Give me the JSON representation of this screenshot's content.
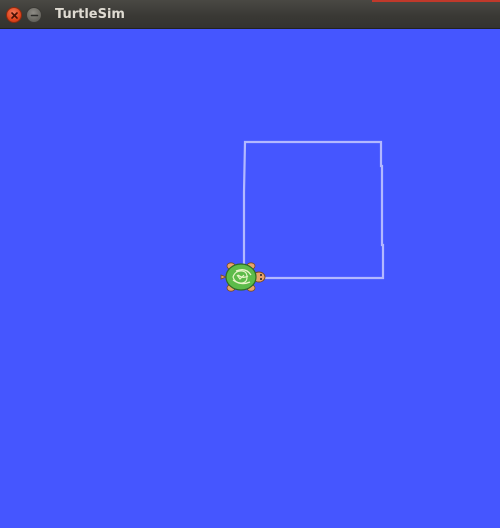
{
  "window": {
    "title": "TurtleSim"
  },
  "colors": {
    "background": "#4556FF",
    "pen": "#B3B8FF",
    "turtle_shell": "#5DBB4A",
    "turtle_skin": "#E9A36A"
  },
  "icons": {
    "close": "close-icon",
    "minimize": "minimize-icon",
    "turtle": "turtle-icon"
  }
}
